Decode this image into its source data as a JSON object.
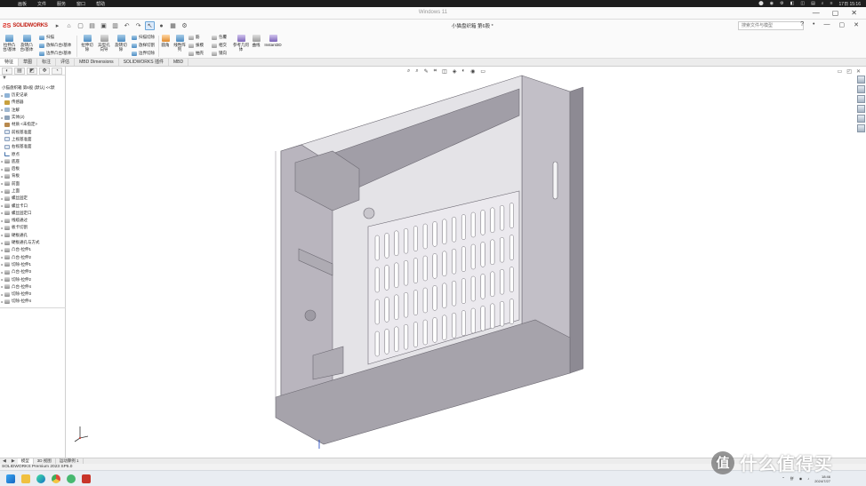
{
  "os_menu": {
    "apple": "",
    "items": [
      "画板",
      "文件",
      "服务",
      "窗口",
      "帮助"
    ],
    "right_icons": [
      "⬤",
      "◉",
      "⚙",
      "◧",
      "◫",
      "▤",
      "⌕",
      "≡"
    ],
    "time": "17日 15:16"
  },
  "title_bar": {
    "window_title": "Windows 11",
    "buttons": [
      "—",
      "▢",
      "✕"
    ]
  },
  "quick_bar": {
    "logo_mark": "ƧS",
    "logo_text": "SOLIDWORKS",
    "doc_name": "小猫盘织箱 第6股 *",
    "search_placeholder": "搜索文件与模型",
    "right_icons": [
      "?",
      "•",
      "—",
      "▢",
      "✕"
    ]
  },
  "ribbon": {
    "buttons": [
      {
        "label": "拉伸凸台/基体",
        "color": "blue"
      },
      {
        "label": "旋转凸台/基体",
        "color": "blue"
      },
      {
        "label": "拉伸切除",
        "color": "blue"
      },
      {
        "label": "异型孔向导",
        "color": "gray"
      },
      {
        "label": "旋转切除",
        "color": "blue"
      },
      {
        "label": "圆角",
        "color": "orange"
      },
      {
        "label": "线性阵列",
        "color": "blue"
      },
      {
        "label": "参考几何体",
        "color": "purple"
      },
      {
        "label": "曲线",
        "color": "gray"
      },
      {
        "label": "Instant3D",
        "color": "purple"
      }
    ],
    "small_left": [
      "扫描",
      "放样凸台/基体",
      "边界凸台/基体"
    ],
    "small_mid": [
      "扫描切除",
      "放样切割",
      "边界切除"
    ],
    "small_right1": [
      "筋",
      "拔模",
      "抽壳"
    ],
    "small_right2": [
      "包覆",
      "相交",
      "镜向"
    ]
  },
  "cm_tabs": [
    "特征",
    "草图",
    "标注",
    "评估",
    "MBD Dimensions",
    "SOLIDWORKS 插件",
    "MBD"
  ],
  "tree": {
    "tabs": [
      "◐",
      "▤",
      "◩",
      "✥",
      "◔"
    ],
    "filter_icon": "▼",
    "root": "小猫盘织箱 第6股 (默认) <<默",
    "items": [
      {
        "label": "历史记录",
        "icon": "hist",
        "arrow": "▸",
        "indent": false
      },
      {
        "label": "传感器",
        "icon": "sens",
        "arrow": "",
        "indent": false
      },
      {
        "label": "注解",
        "icon": "ann",
        "arrow": "▸",
        "indent": false
      },
      {
        "label": "实体(2)",
        "icon": "solid",
        "arrow": "▸",
        "indent": false
      },
      {
        "label": "材质 <未指定>",
        "icon": "mat",
        "arrow": "",
        "indent": false
      },
      {
        "label": "前视基准面",
        "icon": "plane",
        "arrow": "",
        "indent": false
      },
      {
        "label": "上视基准面",
        "icon": "plane",
        "arrow": "",
        "indent": false
      },
      {
        "label": "右视基准面",
        "icon": "plane",
        "arrow": "",
        "indent": false
      },
      {
        "label": "原点",
        "icon": "origin",
        "arrow": "",
        "indent": false
      },
      {
        "label": "底座",
        "icon": "feat",
        "arrow": "▸",
        "indent": false
      },
      {
        "label": "后板",
        "icon": "feat",
        "arrow": "▸",
        "indent": false
      },
      {
        "label": "背板",
        "icon": "feat",
        "arrow": "▸",
        "indent": false
      },
      {
        "label": "前面",
        "icon": "feat",
        "arrow": "▸",
        "indent": false
      },
      {
        "label": "上面",
        "icon": "feat",
        "arrow": "▸",
        "indent": false
      },
      {
        "label": "螺丝固定",
        "icon": "feat",
        "arrow": "▸",
        "indent": false
      },
      {
        "label": "螺丝卡口",
        "icon": "feat",
        "arrow": "▸",
        "indent": false
      },
      {
        "label": "螺丝固定口",
        "icon": "feat",
        "arrow": "▸",
        "indent": false
      },
      {
        "label": "线缆通过",
        "icon": "feat",
        "arrow": "▸",
        "indent": false
      },
      {
        "label": "板卡切割",
        "icon": "feat",
        "arrow": "▸",
        "indent": false
      },
      {
        "label": "硬板通孔",
        "icon": "feat",
        "arrow": "▸",
        "indent": false
      },
      {
        "label": "硬板通孔与方式",
        "icon": "feat",
        "arrow": "▸",
        "indent": false
      },
      {
        "label": "凸台-拉伸1",
        "icon": "feat",
        "arrow": "▸",
        "indent": false
      },
      {
        "label": "凸台-拉伸2",
        "icon": "feat",
        "arrow": "▸",
        "indent": false
      },
      {
        "label": "切除-拉伸1",
        "icon": "feat",
        "arrow": "▸",
        "indent": false
      },
      {
        "label": "凸台-拉伸3",
        "icon": "feat",
        "arrow": "▸",
        "indent": false
      },
      {
        "label": "切除-拉伸2",
        "icon": "feat",
        "arrow": "▸",
        "indent": false
      },
      {
        "label": "凸台-拉伸4",
        "icon": "feat",
        "arrow": "▸",
        "indent": false
      },
      {
        "label": "切除-拉伸3",
        "icon": "feat",
        "arrow": "▸",
        "indent": false
      },
      {
        "label": "切除-拉伸4",
        "icon": "feat",
        "arrow": "▸",
        "indent": false
      }
    ]
  },
  "viewport": {
    "heads_up_icons": [
      "⌕",
      "⌕",
      "✎",
      "⌗",
      "◫",
      "◈",
      "◐",
      "◉",
      "▭"
    ],
    "controls": [
      "▭",
      "◰",
      "✕"
    ],
    "task_pane_count": 6,
    "model_fill": "#a7a4ac",
    "model_fill_light": "#c4c1c8",
    "model_fill_dark": "#8f8c94"
  },
  "model_tabs": {
    "nav": [
      "◀",
      "▶"
    ],
    "tabs": [
      "模型",
      "3D 视图",
      "运动算例 1"
    ]
  },
  "status_bar": {
    "text": "SOLIDWORKS Premium 2023 SP5.0"
  },
  "taskbar": {
    "apps": [
      "win",
      "files",
      "edge",
      "chrome",
      "app1",
      "sw"
    ],
    "tray_icons": [
      "⌃",
      "拼",
      "◉",
      "♪"
    ],
    "time": "18:46",
    "date": "2024/7/27"
  },
  "watermark": {
    "badge": "值",
    "text": "什么值得买"
  }
}
